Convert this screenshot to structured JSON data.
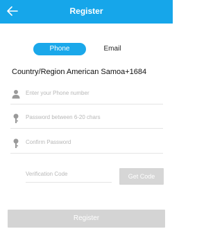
{
  "header": {
    "title": "Register",
    "back_icon": "arrow-left-icon",
    "color": "#16a6ea"
  },
  "tabs": {
    "phone_label": "Phone",
    "email_label": "Email",
    "active": "Phone"
  },
  "region": {
    "text": "Country/Region American Samoa+1684"
  },
  "form": {
    "phone_placeholder": "Enter your Phone number",
    "password_placeholder": "Password between 6-20 chars",
    "confirm_placeholder": "Confirm Password",
    "code_placeholder": "Verification Code",
    "phone_icon": "user-icon",
    "password_icon": "key-icon",
    "confirm_icon": "key-icon"
  },
  "buttons": {
    "get_code_label": "Get Code",
    "register_label": "Register"
  }
}
